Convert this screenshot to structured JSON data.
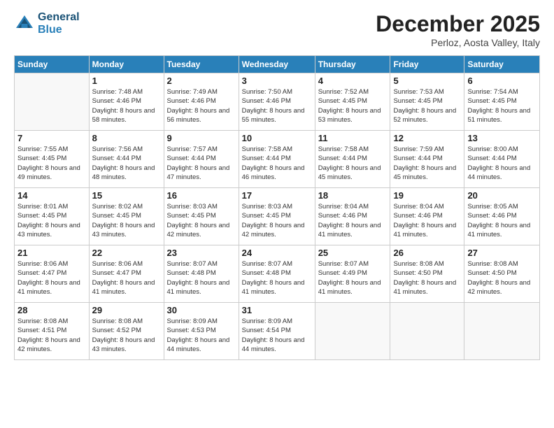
{
  "header": {
    "logo_line1": "General",
    "logo_line2": "Blue",
    "month_title": "December 2025",
    "subtitle": "Perloz, Aosta Valley, Italy"
  },
  "weekdays": [
    "Sunday",
    "Monday",
    "Tuesday",
    "Wednesday",
    "Thursday",
    "Friday",
    "Saturday"
  ],
  "weeks": [
    [
      {
        "day": "",
        "sunrise": "",
        "sunset": "",
        "daylight": ""
      },
      {
        "day": "1",
        "sunrise": "Sunrise: 7:48 AM",
        "sunset": "Sunset: 4:46 PM",
        "daylight": "Daylight: 8 hours and 58 minutes."
      },
      {
        "day": "2",
        "sunrise": "Sunrise: 7:49 AM",
        "sunset": "Sunset: 4:46 PM",
        "daylight": "Daylight: 8 hours and 56 minutes."
      },
      {
        "day": "3",
        "sunrise": "Sunrise: 7:50 AM",
        "sunset": "Sunset: 4:46 PM",
        "daylight": "Daylight: 8 hours and 55 minutes."
      },
      {
        "day": "4",
        "sunrise": "Sunrise: 7:52 AM",
        "sunset": "Sunset: 4:45 PM",
        "daylight": "Daylight: 8 hours and 53 minutes."
      },
      {
        "day": "5",
        "sunrise": "Sunrise: 7:53 AM",
        "sunset": "Sunset: 4:45 PM",
        "daylight": "Daylight: 8 hours and 52 minutes."
      },
      {
        "day": "6",
        "sunrise": "Sunrise: 7:54 AM",
        "sunset": "Sunset: 4:45 PM",
        "daylight": "Daylight: 8 hours and 51 minutes."
      }
    ],
    [
      {
        "day": "7",
        "sunrise": "Sunrise: 7:55 AM",
        "sunset": "Sunset: 4:45 PM",
        "daylight": "Daylight: 8 hours and 49 minutes."
      },
      {
        "day": "8",
        "sunrise": "Sunrise: 7:56 AM",
        "sunset": "Sunset: 4:44 PM",
        "daylight": "Daylight: 8 hours and 48 minutes."
      },
      {
        "day": "9",
        "sunrise": "Sunrise: 7:57 AM",
        "sunset": "Sunset: 4:44 PM",
        "daylight": "Daylight: 8 hours and 47 minutes."
      },
      {
        "day": "10",
        "sunrise": "Sunrise: 7:58 AM",
        "sunset": "Sunset: 4:44 PM",
        "daylight": "Daylight: 8 hours and 46 minutes."
      },
      {
        "day": "11",
        "sunrise": "Sunrise: 7:58 AM",
        "sunset": "Sunset: 4:44 PM",
        "daylight": "Daylight: 8 hours and 45 minutes."
      },
      {
        "day": "12",
        "sunrise": "Sunrise: 7:59 AM",
        "sunset": "Sunset: 4:44 PM",
        "daylight": "Daylight: 8 hours and 45 minutes."
      },
      {
        "day": "13",
        "sunrise": "Sunrise: 8:00 AM",
        "sunset": "Sunset: 4:44 PM",
        "daylight": "Daylight: 8 hours and 44 minutes."
      }
    ],
    [
      {
        "day": "14",
        "sunrise": "Sunrise: 8:01 AM",
        "sunset": "Sunset: 4:45 PM",
        "daylight": "Daylight: 8 hours and 43 minutes."
      },
      {
        "day": "15",
        "sunrise": "Sunrise: 8:02 AM",
        "sunset": "Sunset: 4:45 PM",
        "daylight": "Daylight: 8 hours and 43 minutes."
      },
      {
        "day": "16",
        "sunrise": "Sunrise: 8:03 AM",
        "sunset": "Sunset: 4:45 PM",
        "daylight": "Daylight: 8 hours and 42 minutes."
      },
      {
        "day": "17",
        "sunrise": "Sunrise: 8:03 AM",
        "sunset": "Sunset: 4:45 PM",
        "daylight": "Daylight: 8 hours and 42 minutes."
      },
      {
        "day": "18",
        "sunrise": "Sunrise: 8:04 AM",
        "sunset": "Sunset: 4:46 PM",
        "daylight": "Daylight: 8 hours and 41 minutes."
      },
      {
        "day": "19",
        "sunrise": "Sunrise: 8:04 AM",
        "sunset": "Sunset: 4:46 PM",
        "daylight": "Daylight: 8 hours and 41 minutes."
      },
      {
        "day": "20",
        "sunrise": "Sunrise: 8:05 AM",
        "sunset": "Sunset: 4:46 PM",
        "daylight": "Daylight: 8 hours and 41 minutes."
      }
    ],
    [
      {
        "day": "21",
        "sunrise": "Sunrise: 8:06 AM",
        "sunset": "Sunset: 4:47 PM",
        "daylight": "Daylight: 8 hours and 41 minutes."
      },
      {
        "day": "22",
        "sunrise": "Sunrise: 8:06 AM",
        "sunset": "Sunset: 4:47 PM",
        "daylight": "Daylight: 8 hours and 41 minutes."
      },
      {
        "day": "23",
        "sunrise": "Sunrise: 8:07 AM",
        "sunset": "Sunset: 4:48 PM",
        "daylight": "Daylight: 8 hours and 41 minutes."
      },
      {
        "day": "24",
        "sunrise": "Sunrise: 8:07 AM",
        "sunset": "Sunset: 4:48 PM",
        "daylight": "Daylight: 8 hours and 41 minutes."
      },
      {
        "day": "25",
        "sunrise": "Sunrise: 8:07 AM",
        "sunset": "Sunset: 4:49 PM",
        "daylight": "Daylight: 8 hours and 41 minutes."
      },
      {
        "day": "26",
        "sunrise": "Sunrise: 8:08 AM",
        "sunset": "Sunset: 4:50 PM",
        "daylight": "Daylight: 8 hours and 41 minutes."
      },
      {
        "day": "27",
        "sunrise": "Sunrise: 8:08 AM",
        "sunset": "Sunset: 4:50 PM",
        "daylight": "Daylight: 8 hours and 42 minutes."
      }
    ],
    [
      {
        "day": "28",
        "sunrise": "Sunrise: 8:08 AM",
        "sunset": "Sunset: 4:51 PM",
        "daylight": "Daylight: 8 hours and 42 minutes."
      },
      {
        "day": "29",
        "sunrise": "Sunrise: 8:08 AM",
        "sunset": "Sunset: 4:52 PM",
        "daylight": "Daylight: 8 hours and 43 minutes."
      },
      {
        "day": "30",
        "sunrise": "Sunrise: 8:09 AM",
        "sunset": "Sunset: 4:53 PM",
        "daylight": "Daylight: 8 hours and 44 minutes."
      },
      {
        "day": "31",
        "sunrise": "Sunrise: 8:09 AM",
        "sunset": "Sunset: 4:54 PM",
        "daylight": "Daylight: 8 hours and 44 minutes."
      },
      {
        "day": "",
        "sunrise": "",
        "sunset": "",
        "daylight": ""
      },
      {
        "day": "",
        "sunrise": "",
        "sunset": "",
        "daylight": ""
      },
      {
        "day": "",
        "sunrise": "",
        "sunset": "",
        "daylight": ""
      }
    ]
  ]
}
